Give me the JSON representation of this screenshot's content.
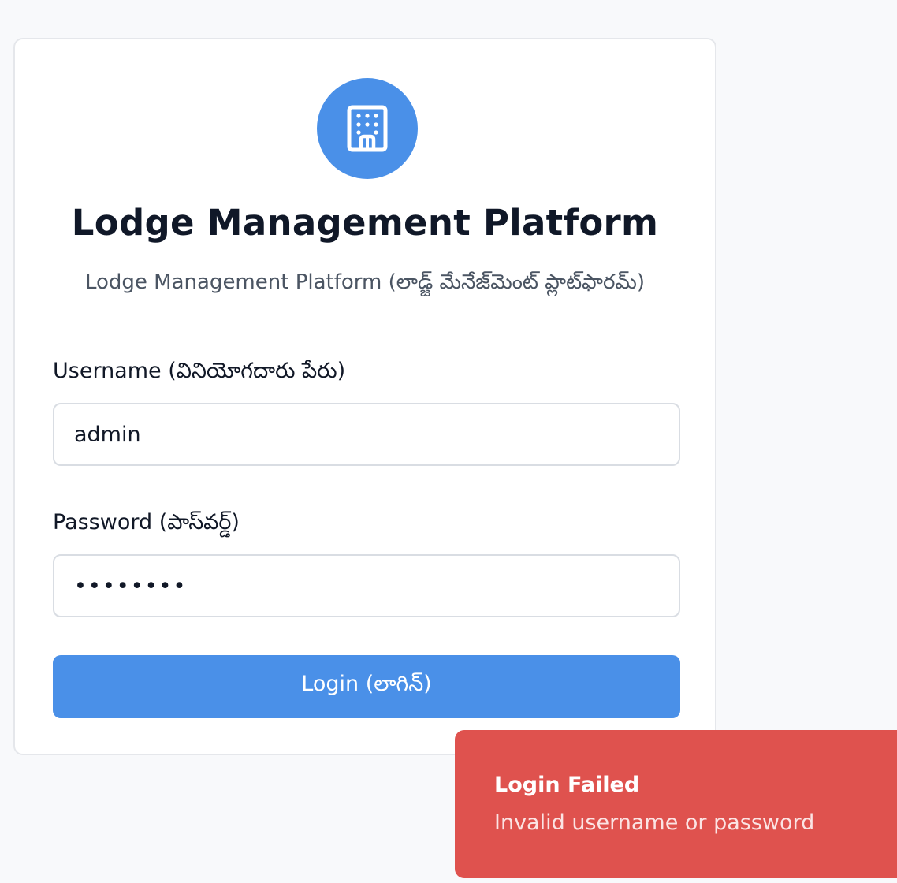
{
  "colors": {
    "accent": "#4a90e8",
    "error": "#df524e",
    "page_bg": "#f8f9fb"
  },
  "login_card": {
    "logo_icon": "building-icon",
    "title": "Lodge Management Platform",
    "subtitle": "Lodge Management Platform (లాడ్జ్ మేనేజ్‌మెంట్ ప్లాట్‌ఫారమ్)",
    "username": {
      "label": "Username (వినియోగదారు పేరు)",
      "value": "admin"
    },
    "password": {
      "label": "Password (పాస్‌వర్డ్)",
      "value": "password"
    },
    "login_button_label": "Login (లాగిన్)"
  },
  "toast": {
    "title": "Login Failed",
    "message": "Invalid username or password"
  }
}
